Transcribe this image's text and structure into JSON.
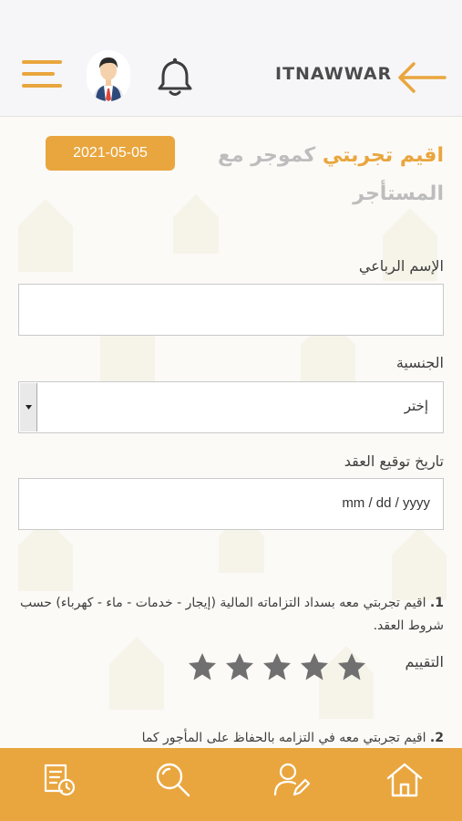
{
  "header": {
    "brand": "ITNAWWAR",
    "menu_icon": "hamburger-menu-icon",
    "avatar_icon": "user-avatar",
    "bell_icon": "bell-icon",
    "back_icon": "arrow-left-icon"
  },
  "page": {
    "date_badge": "2021-05-05",
    "title_accent": "اقيم تجربتي",
    "title_rest": "كموجر مع المستأجر"
  },
  "form": {
    "name_label": "الإسم الرباعي",
    "name_value": "",
    "nationality_label": "الجنسية",
    "nationality_selected": "إختر",
    "contract_date_label": "تاريخ توقيع العقد",
    "contract_date_placeholder": "mm / dd / yyyy"
  },
  "questions": [
    {
      "number": "1.",
      "text": "اقيم تجربتي معه بسداد التزاماته المالية (إيجار - خدمات - ماء - كهرباء) حسب شروط العقد.",
      "rating_label": "التقييم",
      "rating": 0,
      "max_rating": 5
    },
    {
      "number": "2.",
      "text": "اقيم تجربتي معه في التزامه بالحفاظ على المأجور كما"
    }
  ],
  "bottom_nav": {
    "items": [
      "document-history-icon",
      "search-icon",
      "edit-user-icon",
      "home-icon"
    ]
  },
  "colors": {
    "accent": "#e9a63e",
    "star_empty": "#707070",
    "header_bg": "#f6f6f8"
  }
}
